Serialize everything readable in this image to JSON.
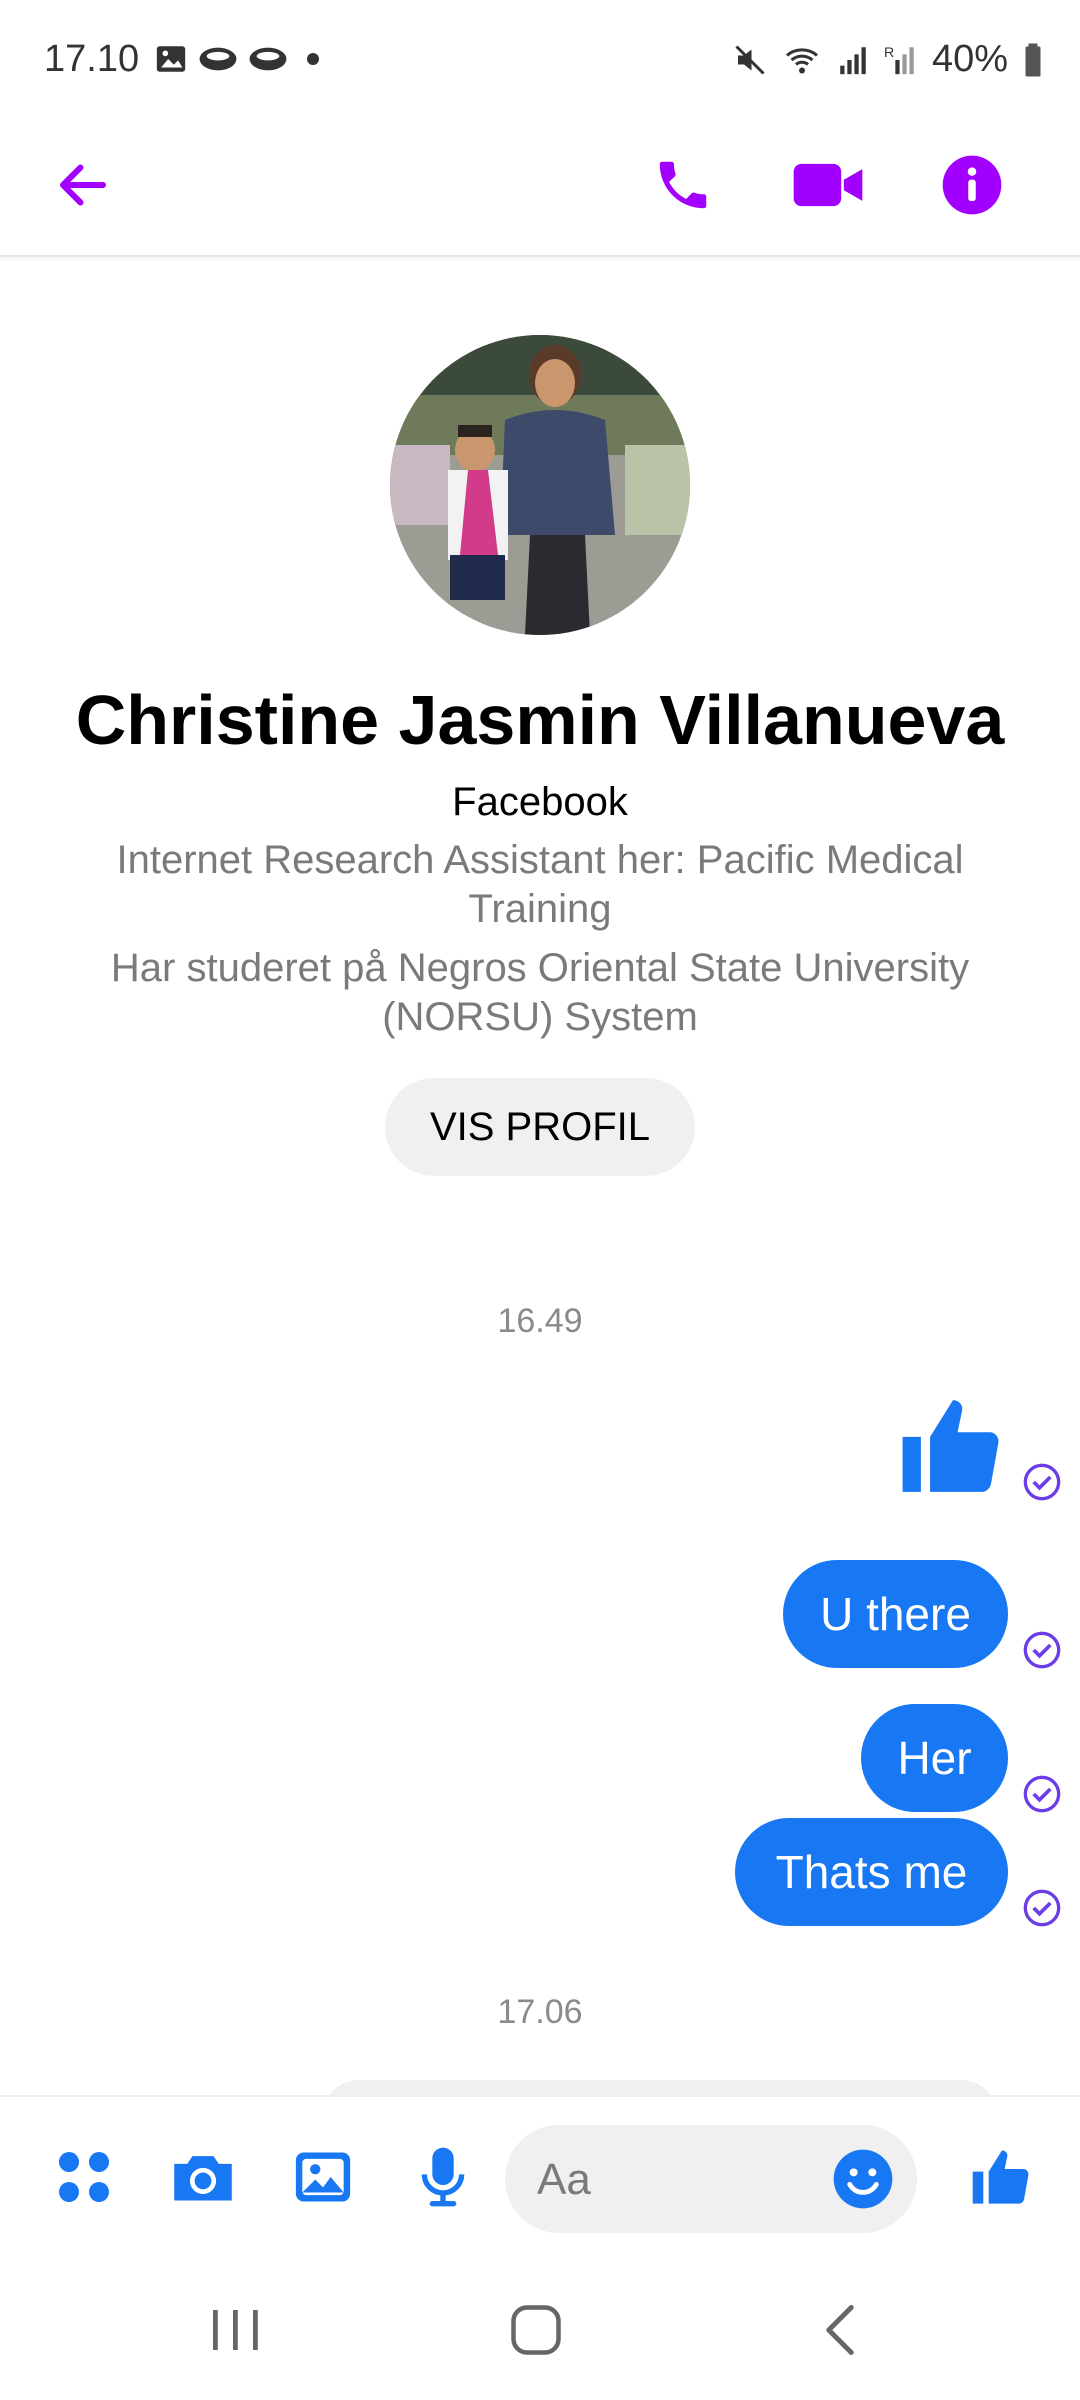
{
  "status_bar": {
    "time": "17.10",
    "battery": "40%",
    "icons": [
      "gallery-icon",
      "cloud-icon",
      "cloud-icon",
      "dot-icon",
      "mute-icon",
      "wifi-icon",
      "signal-icon",
      "signal-roaming-icon",
      "battery-icon"
    ]
  },
  "app_bar": {
    "icons": [
      "back-arrow-icon",
      "phone-icon",
      "video-camera-icon",
      "info-icon"
    ],
    "accent_color": "#a100ff"
  },
  "profile": {
    "name": "Christine Jasmin Villanueva",
    "platform": "Facebook",
    "work": "Internet Research Assistant her: Pacific Medical Training",
    "education": "Har studeret på Negros Oriental State University (NORSU) System",
    "view_profile_label": "VIS PROFIL"
  },
  "messages": {
    "timestamp_1": "16.49",
    "like_sticker": "thumbs-up-icon",
    "msg_1": "U there",
    "msg_2": "Her",
    "msg_3": "Thats me",
    "timestamp_2": "17.06",
    "bubble_color": "#1877f2",
    "check_color": "#6a3de8"
  },
  "composer": {
    "placeholder": "Aa",
    "icons": [
      "apps-icon",
      "camera-icon",
      "gallery-icon",
      "microphone-icon",
      "emoji-icon",
      "thumbs-up-icon"
    ],
    "icon_color": "#1877f2"
  },
  "nav_bar": {
    "icons": [
      "recent-apps-icon",
      "home-icon",
      "back-icon"
    ]
  }
}
